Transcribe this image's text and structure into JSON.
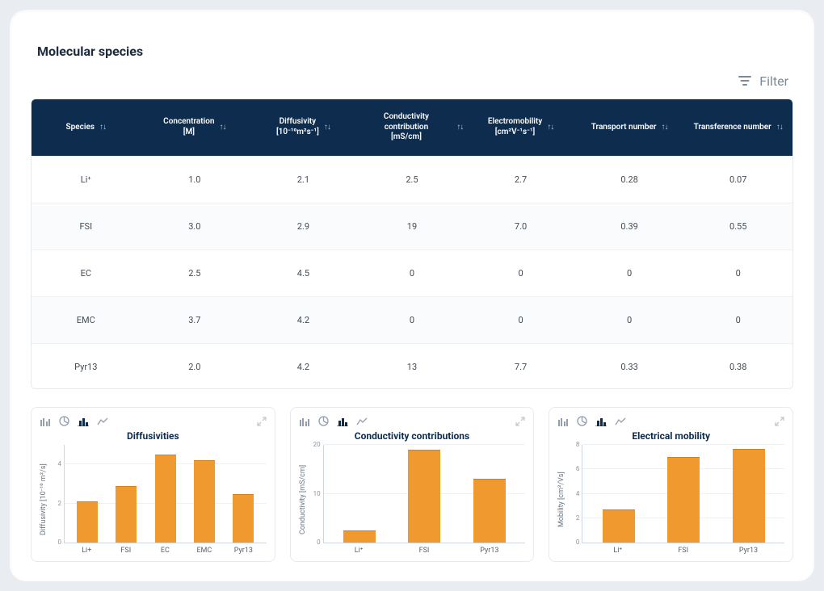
{
  "page": {
    "title": "Molecular species"
  },
  "filter": {
    "label": "Filter"
  },
  "table": {
    "columns": [
      "Species",
      "Concentration [M]",
      "Diffusivity [10⁻¹⁰m²s⁻¹]",
      "Conductivity contribution [mS/cm]",
      "Electromobility [cm²V⁻¹s⁻¹]",
      "Transport number",
      "Transference number"
    ],
    "rows": [
      {
        "species": "Li⁺",
        "conc": "1.0",
        "diff": "2.1",
        "cond": "2.5",
        "mob": "2.7",
        "transport": "0.28",
        "transference": "0.07"
      },
      {
        "species": "FSI",
        "conc": "3.0",
        "diff": "2.9",
        "cond": "19",
        "mob": "7.0",
        "transport": "0.39",
        "transference": "0.55"
      },
      {
        "species": "EC",
        "conc": "2.5",
        "diff": "4.5",
        "cond": "0",
        "mob": "0",
        "transport": "0",
        "transference": "0"
      },
      {
        "species": "EMC",
        "conc": "3.7",
        "diff": "4.2",
        "cond": "0",
        "mob": "0",
        "transport": "0",
        "transference": "0"
      },
      {
        "species": "Pyr13",
        "conc": "2.0",
        "diff": "4.2",
        "cond": "13",
        "mob": "7.7",
        "transport": "0.33",
        "transference": "0.38"
      }
    ]
  },
  "charts": [
    {
      "title": "Diffusivities",
      "ylabel": "Diffusivity [10⁻¹⁰ m²/s]"
    },
    {
      "title": "Conductivity contributions",
      "ylabel": "Conductivity [mS/cm]"
    },
    {
      "title": "Electrical mobility",
      "ylabel": "Mobility [cm²/Vs]"
    }
  ],
  "chart_data": [
    {
      "type": "bar",
      "title": "Diffusivities",
      "ylabel": "Diffusivity [10⁻¹⁰ m²/s]",
      "ylim": [
        0,
        5
      ],
      "yticks": [
        0,
        2,
        4
      ],
      "categories": [
        "Li+",
        "FSI",
        "EC",
        "EMC",
        "Pyr13"
      ],
      "values": [
        2.1,
        2.9,
        4.5,
        4.2,
        2.5
      ]
    },
    {
      "type": "bar",
      "title": "Conductivity contributions",
      "ylabel": "Conductivity [mS/cm]",
      "ylim": [
        0,
        20
      ],
      "yticks": [
        0,
        10,
        20
      ],
      "categories": [
        "Li⁺",
        "FSI",
        "Pyr13"
      ],
      "values": [
        2.5,
        19,
        13
      ]
    },
    {
      "type": "bar",
      "title": "Electrical mobility",
      "ylabel": "Mobility [cm²/Vs]",
      "ylim": [
        0,
        8
      ],
      "yticks": [
        0,
        2,
        4,
        6,
        8
      ],
      "categories": [
        "Li⁺",
        "FSI",
        "Pyr13"
      ],
      "values": [
        2.7,
        7.0,
        7.7
      ]
    }
  ]
}
